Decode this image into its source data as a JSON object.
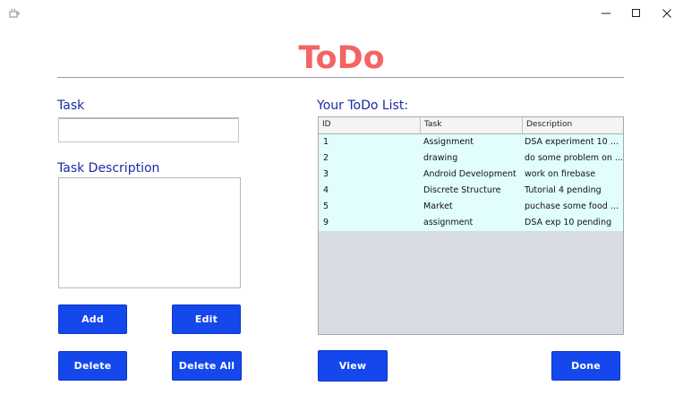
{
  "window": {
    "title_text": "",
    "controls": {
      "minimize": "—",
      "maximize": "☐",
      "close": "✕"
    }
  },
  "header": {
    "title": "ToDo"
  },
  "form": {
    "task_label": "Task",
    "task_value": "",
    "description_label": "Task Description",
    "description_value": ""
  },
  "buttons": {
    "add": "Add",
    "edit": "Edit",
    "delete": "Delete",
    "delete_all": "Delete All",
    "view": "View",
    "done": "Done"
  },
  "list": {
    "label": "Your ToDo List:",
    "columns": [
      "ID",
      "Task",
      "Description"
    ],
    "rows": [
      {
        "id": "1",
        "task": "Assignment",
        "description": "DSA experiment 10 p..."
      },
      {
        "id": "2",
        "task": "drawing",
        "description": "do some problem on ..."
      },
      {
        "id": "3",
        "task": "Android Development",
        "description": "work on firebase"
      },
      {
        "id": "4",
        "task": "Discrete Structure",
        "description": "Tutorial 4 pending"
      },
      {
        "id": "5",
        "task": "Market",
        "description": "puchase some food a..."
      },
      {
        "id": "9",
        "task": "assignment",
        "description": "DSA exp 10 pending"
      }
    ]
  },
  "colors": {
    "title": "#f46464",
    "label": "#1a2aa6",
    "button": "#1448ec",
    "row_bg": "#e2fdfd",
    "table_empty_bg": "#d7dbe2"
  },
  "icons": {
    "app": "java-cup-icon"
  }
}
